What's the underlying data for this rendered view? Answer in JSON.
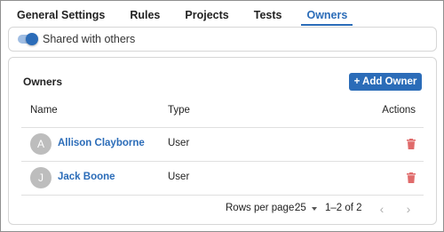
{
  "tabs": [
    {
      "label": "General Settings",
      "active": false
    },
    {
      "label": "Rules",
      "active": false
    },
    {
      "label": "Projects",
      "active": false
    },
    {
      "label": "Tests",
      "active": false
    },
    {
      "label": "Owners",
      "active": true
    }
  ],
  "share": {
    "label": "Shared with others",
    "enabled": true
  },
  "owners_panel": {
    "title": "Owners",
    "add_button_label": "+ Add Owner",
    "columns": {
      "name": "Name",
      "type": "Type",
      "actions": "Actions"
    },
    "rows": [
      {
        "initial": "A",
        "name": "Allison Clayborne",
        "type": "User",
        "action_icon": "trash-icon"
      },
      {
        "initial": "J",
        "name": "Jack Boone",
        "type": "User",
        "action_icon": "trash-icon"
      }
    ]
  },
  "pagination": {
    "rows_per_page_label": "Rows per page:",
    "rows_per_page_value": "25",
    "range_text": "1–2 of 2",
    "prev_icon": "chevron-left-icon",
    "next_icon": "chevron-right-icon"
  },
  "colors": {
    "accent": "#2b6cb8",
    "delete_icon": "#e06b6b",
    "avatar_bg": "#bdbdbd",
    "border": "#d6d6d6"
  }
}
